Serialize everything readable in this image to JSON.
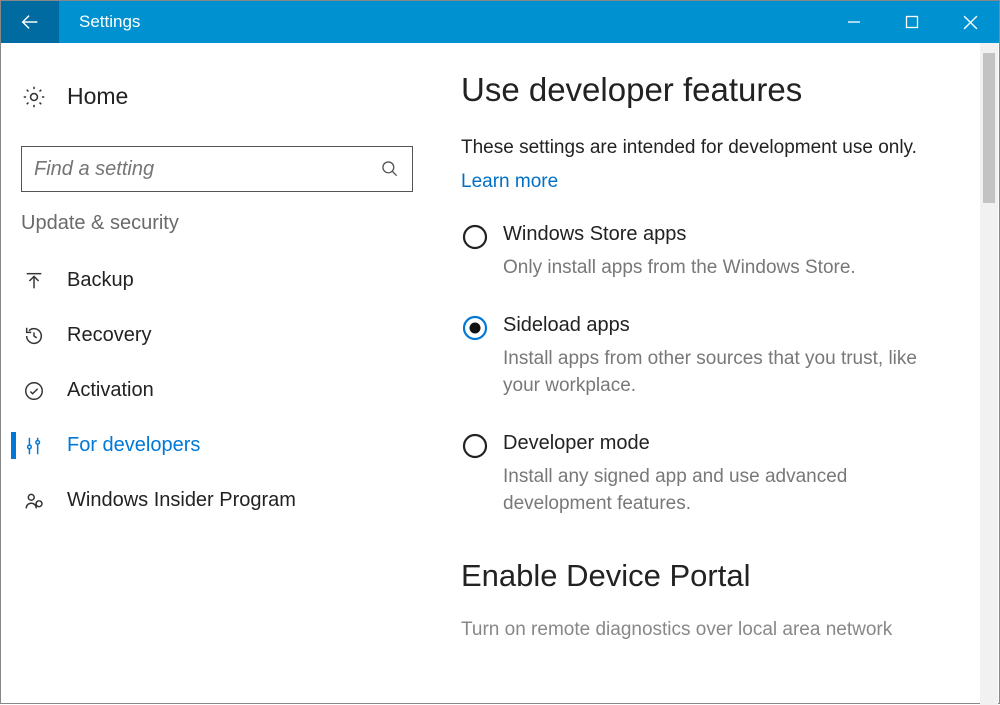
{
  "titlebar": {
    "title": "Settings"
  },
  "sidebar": {
    "home_label": "Home",
    "search_placeholder": "Find a setting",
    "category_label": "Update & security",
    "items": [
      {
        "label": "Backup",
        "icon": "arrow-up-line",
        "selected": false
      },
      {
        "label": "Recovery",
        "icon": "history",
        "selected": false
      },
      {
        "label": "Activation",
        "icon": "check-circle",
        "selected": false
      },
      {
        "label": "For developers",
        "icon": "tools",
        "selected": true
      },
      {
        "label": "Windows Insider Program",
        "icon": "person-ring",
        "selected": false
      }
    ]
  },
  "main": {
    "heading": "Use developer features",
    "description": "These settings are intended for development use only.",
    "learn_more": "Learn more",
    "options": [
      {
        "title": "Windows Store apps",
        "desc": "Only install apps from the Windows Store.",
        "selected": false
      },
      {
        "title": "Sideload apps",
        "desc": "Install apps from other sources that you trust, like your workplace.",
        "selected": true
      },
      {
        "title": "Developer mode",
        "desc": "Install any signed app and use advanced development features.",
        "selected": false
      }
    ],
    "portal_heading": "Enable Device Portal",
    "portal_desc": "Turn on remote diagnostics over local area network"
  }
}
